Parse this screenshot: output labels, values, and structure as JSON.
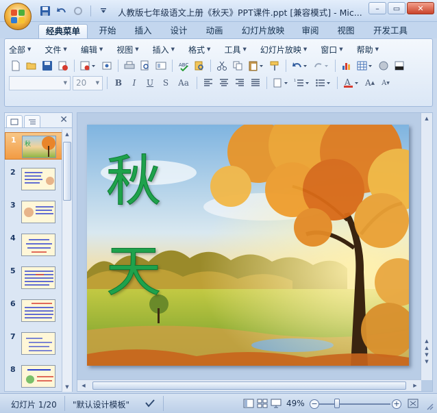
{
  "window": {
    "title": "人教版七年级语文上册《秋天》PPT课件.ppt [兼容模式] - Mic...",
    "controls": {
      "minimize": "–",
      "restore": "▭",
      "close": "✕"
    }
  },
  "ribbon_tabs": [
    "经典菜单",
    "开始",
    "插入",
    "设计",
    "动画",
    "幻灯片放映",
    "审阅",
    "视图",
    "开发工具"
  ],
  "menu_bar": [
    "全部",
    "文件",
    "编辑",
    "视图",
    "插入",
    "格式",
    "工具",
    "幻灯片放映",
    "窗口",
    "帮助"
  ],
  "format": {
    "font_name": "",
    "font_size": "20"
  },
  "slides_panel": {
    "slide_numbers": [
      "1",
      "2",
      "3",
      "4",
      "5",
      "6",
      "7",
      "8"
    ],
    "selected_index": 0
  },
  "slide": {
    "title_line1": "秋",
    "title_line2": "天"
  },
  "status_bar": {
    "slide_indicator": "幻灯片 1/20",
    "template": "\"默认设计模板\"",
    "zoom": "49%"
  },
  "colors": {
    "accent": "#f29b43",
    "title_green": "#1fa24c",
    "ribbon_blue": "#c3d6ee"
  }
}
